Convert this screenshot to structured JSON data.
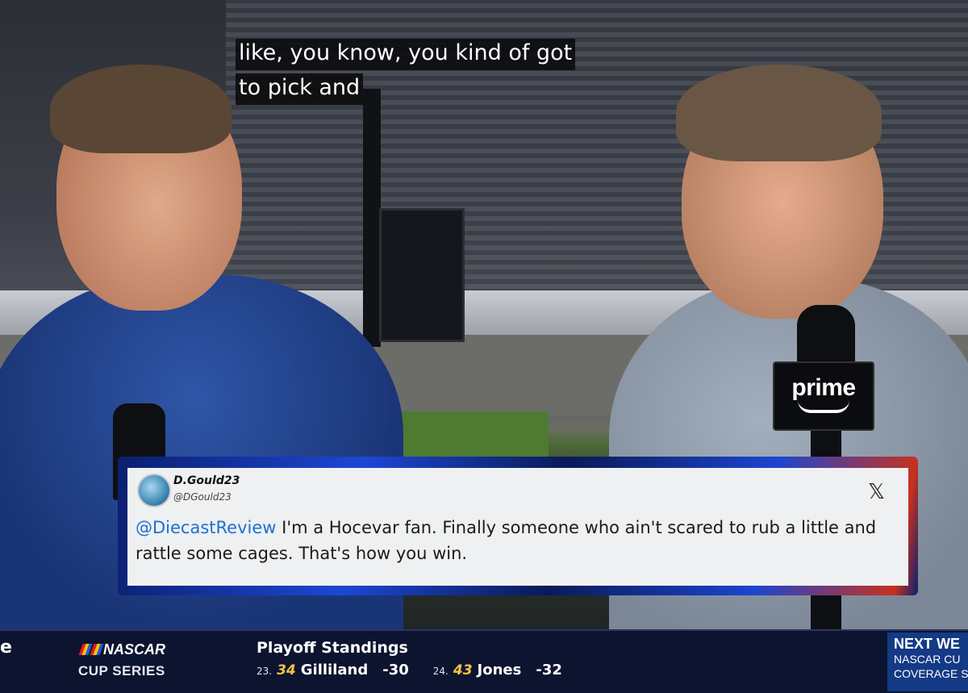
{
  "captions": {
    "line1": "like, you know, you kind of got",
    "line2": "to pick and"
  },
  "mic_flag": {
    "brand": "prime"
  },
  "tweet": {
    "display_name": "D.Gould23",
    "handle": "@DGould23",
    "platform_icon": "x-logo-icon",
    "mention": "@DiecastReview",
    "text": " I'm a Hocevar fan. Finally someone who ain't scared to rub a little and rattle some cages. That's how you win."
  },
  "ticker": {
    "edge_letter": "e",
    "logo": "NASCAR",
    "series": "CUP SERIES",
    "standings_title": "Playoff Standings",
    "standings": [
      {
        "position": "23.",
        "car_number": "34",
        "driver": "Gilliland",
        "points": "-30"
      },
      {
        "position": "24.",
        "car_number": "43",
        "driver": "Jones",
        "points": "-32"
      }
    ],
    "next": {
      "title": "NEXT WE",
      "line2": "NASCAR CU",
      "line3": "COVERAGE STA"
    }
  },
  "colors": {
    "ticker_bg": "#0d1430",
    "mention": "#1d6fd4",
    "car_number": "#f3c443",
    "frame_blue": "#1d47d4"
  }
}
